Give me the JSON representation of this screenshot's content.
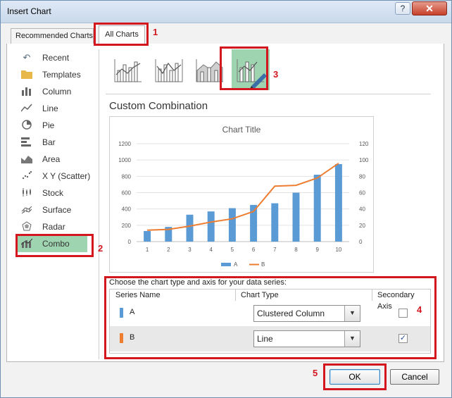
{
  "window": {
    "title": "Insert Chart",
    "help_label": "?",
    "close_label": "✕"
  },
  "tabs": {
    "recommended": "Recommended Charts",
    "all": "All Charts"
  },
  "annotations": [
    "1",
    "2",
    "3",
    "4",
    "5"
  ],
  "categories": [
    {
      "label": "Recent",
      "icon": "recent-icon"
    },
    {
      "label": "Templates",
      "icon": "folder-icon"
    },
    {
      "label": "Column",
      "icon": "column-chart-icon"
    },
    {
      "label": "Line",
      "icon": "line-chart-icon"
    },
    {
      "label": "Pie",
      "icon": "pie-chart-icon"
    },
    {
      "label": "Bar",
      "icon": "bar-chart-icon"
    },
    {
      "label": "Area",
      "icon": "area-chart-icon"
    },
    {
      "label": "X Y (Scatter)",
      "icon": "scatter-chart-icon"
    },
    {
      "label": "Stock",
      "icon": "stock-chart-icon"
    },
    {
      "label": "Surface",
      "icon": "surface-chart-icon"
    },
    {
      "label": "Radar",
      "icon": "radar-chart-icon"
    },
    {
      "label": "Combo",
      "icon": "combo-chart-icon"
    }
  ],
  "selected_category": "Combo",
  "section_title": "Custom Combination",
  "chart_data": {
    "type": "bar",
    "title": "Chart Title",
    "categories": [
      "1",
      "2",
      "3",
      "4",
      "5",
      "6",
      "7",
      "8",
      "9",
      "10"
    ],
    "series": [
      {
        "name": "A",
        "type": "bar",
        "axis": "primary",
        "values": [
          130,
          180,
          330,
          370,
          410,
          450,
          470,
          600,
          820,
          950
        ]
      },
      {
        "name": "B",
        "type": "line",
        "axis": "secondary",
        "values": [
          14,
          15,
          19,
          24,
          28,
          37,
          68,
          69,
          78,
          96
        ]
      }
    ],
    "ylim": [
      0,
      1200
    ],
    "y2lim": [
      0,
      120
    ],
    "yticks": [
      "0",
      "200",
      "400",
      "600",
      "800",
      "1000",
      "1200"
    ],
    "y2ticks": [
      "0",
      "20",
      "40",
      "60",
      "80",
      "100",
      "120"
    ],
    "legend": "bottom",
    "colors": {
      "A": "#5b9bd5",
      "B": "#ed7d31"
    }
  },
  "config": {
    "heading": "Choose the chart type and axis for your data series:",
    "col_series": "Series Name",
    "col_type": "Chart Type",
    "col_secondary": "Secondary Axis",
    "rows": [
      {
        "name": "A",
        "chart_type": "Clustered Column",
        "secondary": false,
        "color": "#5b9bd5"
      },
      {
        "name": "B",
        "chart_type": "Line",
        "secondary": true,
        "color": "#ed7d31"
      }
    ]
  },
  "buttons": {
    "ok": "OK",
    "cancel": "Cancel"
  }
}
